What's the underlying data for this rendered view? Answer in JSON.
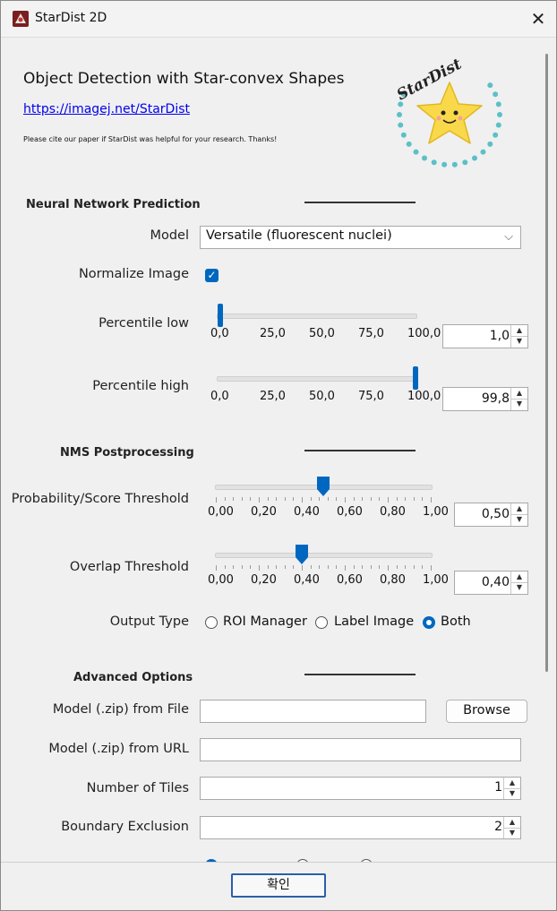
{
  "window": {
    "title": "StarDist 2D",
    "close_glyph": "✕"
  },
  "header": {
    "title": "Object Detection with Star-convex Shapes",
    "link": "https://imagej.net/StarDist",
    "cite": "Please cite our paper if StarDist was helpful for your research. Thanks!",
    "logo_text": "StarDist"
  },
  "nn": {
    "section": "Neural Network Prediction",
    "model_label": "Model",
    "model_value": "Versatile (fluorescent nuclei)",
    "normalize_label": "Normalize Image",
    "normalize_checked": true,
    "pct_low_label": "Percentile low",
    "pct_low_value": "1,0",
    "pct_low_slider": 1.0,
    "pct_high_label": "Percentile high",
    "pct_high_value": "99,8",
    "pct_high_slider": 99.8,
    "pct_ticks": [
      "0,0",
      "25,0",
      "50,0",
      "75,0",
      "100,0"
    ]
  },
  "nms": {
    "section": "NMS Postprocessing",
    "prob_label": "Probability/Score Threshold",
    "prob_value": "0,50",
    "prob_slider": 0.5,
    "overlap_label": "Overlap Threshold",
    "overlap_value": "0,40",
    "overlap_slider": 0.4,
    "ticks": [
      "0,00",
      "0,20",
      "0,40",
      "0,60",
      "0,80",
      "1,00"
    ],
    "output_label": "Output Type",
    "output_options": [
      "ROI Manager",
      "Label Image",
      "Both"
    ],
    "output_selected": "Both"
  },
  "adv": {
    "section": "Advanced Options",
    "file_label": "Model (.zip) from File",
    "file_value": "",
    "browse_label": "Browse",
    "url_label": "Model (.zip) from URL",
    "url_value": "",
    "tiles_label": "Number of Tiles",
    "tiles_value": "1",
    "boundary_label": "Boundary Exclusion",
    "boundary_value": "2"
  },
  "footer": {
    "ok_label": "확인"
  },
  "colors": {
    "accent": "#0067c0",
    "link": "#0000ee",
    "logo_star": "#f9d949",
    "logo_dots": "#5bc0c8"
  }
}
